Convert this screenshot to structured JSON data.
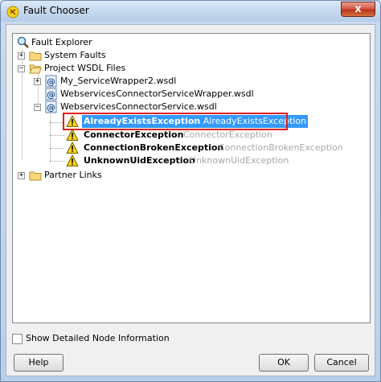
{
  "window": {
    "title": "Fault Chooser",
    "close_label": "x"
  },
  "tree": {
    "root": "Fault Explorer",
    "system_faults": "System Faults",
    "project_wsdl": "Project WSDL Files",
    "wsdl_files": [
      "My_ServiceWrapper2.wsdl",
      "WebservicesConnectorServiceWrapper.wsdl",
      "WebservicesConnectorService.wsdl"
    ],
    "faults": [
      {
        "name": "AlreadyExistsException",
        "type": "AlreadyExistsException"
      },
      {
        "name": "ConnectorException",
        "type": "ConnectorException"
      },
      {
        "name": "ConnectionBrokenException",
        "type": "ConnectionBrokenException"
      },
      {
        "name": "UnknownUidException",
        "type": "UnknownUidException"
      }
    ],
    "partner_links": "Partner Links"
  },
  "options": {
    "show_detailed": "Show Detailed Node Information"
  },
  "buttons": {
    "help": "Help",
    "ok": "OK",
    "cancel": "Cancel"
  },
  "colors": {
    "selection": "#3399ff",
    "highlight_border": "#e0201b",
    "warning": "#f7d11c"
  }
}
